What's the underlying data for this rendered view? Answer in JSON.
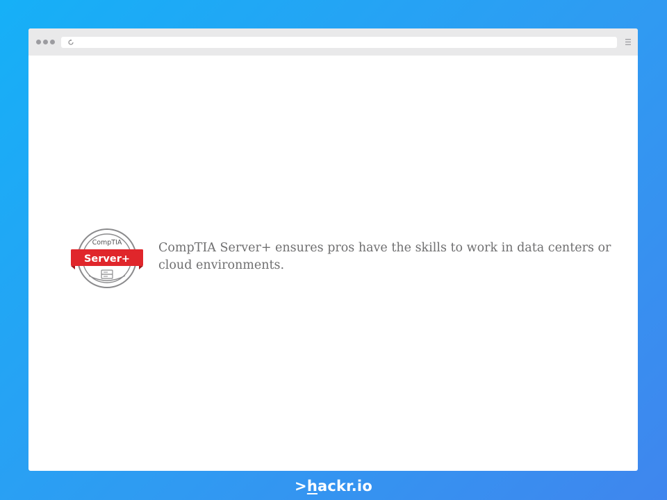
{
  "browser": {
    "address_value": "",
    "reload_icon": "reload-icon",
    "menu_icon": "hamburger-menu-icon"
  },
  "content": {
    "badge": {
      "vendor": "CompTIA",
      "certification": "Server+",
      "colors": {
        "ribbon": "#e0262b",
        "ring": "#8a8a8c"
      }
    },
    "description": "CompTIA Server+ ensures pros have the skills to work in data centers or cloud environments."
  },
  "brand": {
    "prefix": ">",
    "first_letter": "h",
    "rest": "ackr.io"
  },
  "colors": {
    "background_start": "#16b0f7",
    "background_end": "#3f86ee",
    "text": "#6f6f70",
    "toolbar": "#e9e9ea"
  }
}
